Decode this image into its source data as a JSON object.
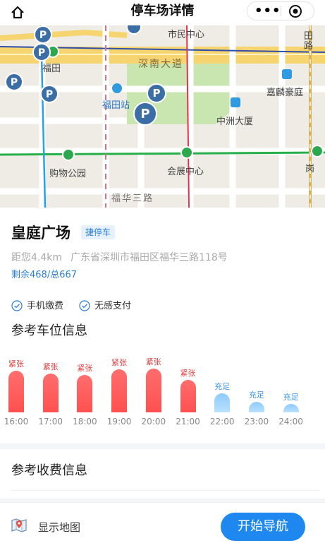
{
  "header": {
    "title": "停车场详情"
  },
  "map_labels": {
    "futian": "福田",
    "futian_station": "福田站",
    "shenzhen_road": "深南大道",
    "shimin_center": "市民中心",
    "jialin": "嘉麟豪庭",
    "zhongzhou": "中洲大厦",
    "shopping_park": "购物公园",
    "convention": "会展中心",
    "fuhua3": "福华三路",
    "gang": "岗",
    "right_top": "田",
    "right_top2": "路"
  },
  "parking": {
    "name": "皇庭广场",
    "tag": "捷停车",
    "distance": "距您4.4km",
    "address": "广东省深圳市福田区福华三路118号",
    "remaining": "剩余468/总667"
  },
  "features": [
    "手机缴费",
    "无感支付"
  ],
  "sections": {
    "spot_info": "参考车位信息",
    "fee_info": "参考收费信息"
  },
  "chart_data": {
    "type": "bar",
    "categories": [
      "16:00",
      "17:00",
      "18:00",
      "19:00",
      "20:00",
      "21:00",
      "22:00",
      "23:00",
      "24:00"
    ],
    "status": [
      "紧张",
      "紧张",
      "紧张",
      "紧张",
      "紧张",
      "紧张",
      "充足",
      "充足",
      "充足"
    ],
    "values": [
      0.62,
      0.58,
      0.56,
      0.64,
      0.65,
      0.48,
      0.28,
      0.16,
      0.13
    ],
    "colors": {
      "tight": "#ff5a5a",
      "ample": "#9fd3ff"
    }
  },
  "bottom": {
    "show_map": "显示地图",
    "navigate": "开始导航"
  }
}
